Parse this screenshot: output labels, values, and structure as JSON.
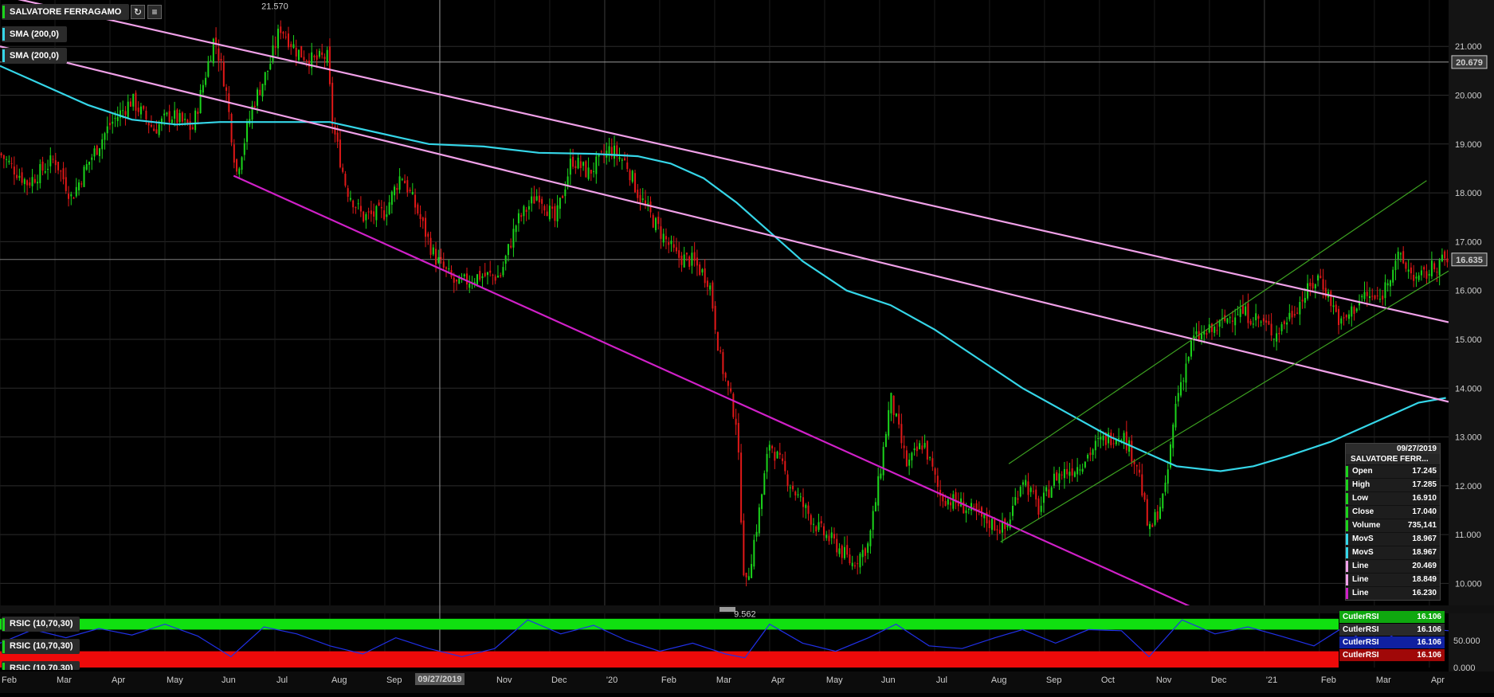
{
  "overlays": {
    "instrument": "SALVATORE FERRAGAMO",
    "sma_1": "SMA (200,0)",
    "sma_2": "SMA (200,0)",
    "rsi_1": "RSIC (10,70,30)",
    "rsi_2": "RSIC (10,70,30)",
    "rsi_3": "RSIC (10,70,30)"
  },
  "colors": {
    "up": "#1bd41b",
    "down": "#e01818",
    "sma": "#35d6e8",
    "channel_line": "#f0a0e8",
    "lower_line": "#d020c8",
    "green_channel": "#3ca020",
    "rsi_line": "#2030e8",
    "rsi_overbought": "#10e010",
    "rsi_oversold": "#ee0a0a"
  },
  "info_panel": {
    "date": "09/27/2019",
    "name": "SALVATORE FERR...",
    "rows": [
      {
        "k": "Open",
        "v": "17.245",
        "c": "#1bd41b"
      },
      {
        "k": "High",
        "v": "17.285",
        "c": "#1bd41b"
      },
      {
        "k": "Low",
        "v": "16.910",
        "c": "#1bd41b"
      },
      {
        "k": "Close",
        "v": "17.040",
        "c": "#1bd41b"
      },
      {
        "k": "Volume",
        "v": "735,141",
        "c": "#1bd41b"
      },
      {
        "k": "MovS",
        "v": "18.967",
        "c": "#35d6e8"
      },
      {
        "k": "MovS",
        "v": "18.967",
        "c": "#35d6e8"
      },
      {
        "k": "Line",
        "v": "20.469",
        "c": "#f0a0e8"
      },
      {
        "k": "Line",
        "v": "18.849",
        "c": "#f0a0e8"
      },
      {
        "k": "Line",
        "v": "16.230",
        "c": "#d020c8"
      }
    ]
  },
  "rsi_panel": {
    "rows": [
      {
        "k": "CutlerRSI",
        "v": "16.106",
        "c": "#0fa80f"
      },
      {
        "k": "CutlerRSI",
        "v": "16.106",
        "c": "#2a2a2a"
      },
      {
        "k": "CutlerRSI",
        "v": "16.106",
        "c": "#1020a0"
      },
      {
        "k": "CutlerRSI",
        "v": "16.106",
        "c": "#a00808"
      }
    ]
  },
  "chart_data": {
    "type": "candlestick",
    "instrument": "SALVATORE FERRAGAMO",
    "price_axis": {
      "ylim": [
        9.55,
        21.95
      ],
      "ticks": [
        "21.000",
        "20.000",
        "19.000",
        "18.000",
        "17.000",
        "16.000",
        "15.000",
        "14.000",
        "13.000",
        "12.000",
        "11.000",
        "10.000"
      ]
    },
    "time_axis": {
      "labels": [
        "Feb",
        "Mar",
        "Apr",
        "May",
        "Jun",
        "Jul",
        "Aug",
        "Sep",
        "09/27/2019",
        "Nov",
        "Dec",
        "'20",
        "Feb",
        "Mar",
        "Apr",
        "May",
        "Jun",
        "Jul",
        "Aug",
        "Sep",
        "Oct",
        "Nov",
        "Dec",
        "'21",
        "Feb",
        "Mar",
        "Apr"
      ],
      "label_month_index": [
        0,
        1,
        2,
        3,
        4,
        5,
        6,
        7,
        8,
        9,
        10,
        11,
        12,
        13,
        14,
        15,
        16,
        17,
        18,
        19,
        20,
        21,
        22,
        23,
        24,
        25,
        26
      ],
      "domain_months": [
        0,
        26.35
      ]
    },
    "price_labels": {
      "current": "16.635",
      "current_value": 16.635,
      "level": "20.679",
      "level_value": 20.679,
      "high": "21.570",
      "high_value": 21.57,
      "high_month": 5.0,
      "low": "9.562",
      "low_value": 9.562,
      "low_month": 13.55
    },
    "close_path": [
      [
        0.0,
        18.8
      ],
      [
        0.5,
        18.2
      ],
      [
        1.0,
        18.7
      ],
      [
        1.3,
        17.9
      ],
      [
        1.6,
        18.6
      ],
      [
        2.0,
        19.4
      ],
      [
        2.4,
        19.9
      ],
      [
        2.8,
        19.3
      ],
      [
        3.1,
        19.6
      ],
      [
        3.5,
        19.3
      ],
      [
        3.9,
        21.2
      ],
      [
        4.1,
        20.2
      ],
      [
        4.3,
        18.4
      ],
      [
        4.6,
        19.8
      ],
      [
        4.9,
        20.6
      ],
      [
        5.1,
        21.4
      ],
      [
        5.4,
        20.9
      ],
      [
        5.7,
        20.7
      ],
      [
        5.95,
        20.8
      ],
      [
        6.05,
        19.4
      ],
      [
        6.3,
        18.1
      ],
      [
        6.6,
        17.5
      ],
      [
        7.0,
        17.6
      ],
      [
        7.3,
        18.4
      ],
      [
        7.6,
        17.6
      ],
      [
        7.9,
        16.7
      ],
      [
        8.3,
        16.1
      ],
      [
        8.7,
        16.3
      ],
      [
        9.1,
        16.3
      ],
      [
        9.4,
        17.4
      ],
      [
        9.8,
        18.0
      ],
      [
        10.1,
        17.4
      ],
      [
        10.4,
        18.7
      ],
      [
        10.7,
        18.4
      ],
      [
        11.1,
        18.9
      ],
      [
        11.4,
        18.6
      ],
      [
        11.6,
        18.0
      ],
      [
        11.9,
        17.4
      ],
      [
        12.3,
        16.7
      ],
      [
        12.6,
        16.6
      ],
      [
        12.9,
        16.2
      ],
      [
        13.1,
        14.6
      ],
      [
        13.4,
        13.3
      ],
      [
        13.55,
        9.8
      ],
      [
        13.8,
        11.4
      ],
      [
        14.0,
        12.9
      ],
      [
        14.3,
        12.2
      ],
      [
        14.6,
        11.6
      ],
      [
        14.9,
        11.1
      ],
      [
        15.2,
        10.8
      ],
      [
        15.5,
        10.4
      ],
      [
        15.8,
        10.8
      ],
      [
        16.0,
        12.2
      ],
      [
        16.2,
        13.8
      ],
      [
        16.5,
        12.4
      ],
      [
        16.8,
        12.9
      ],
      [
        17.1,
        11.8
      ],
      [
        17.5,
        11.6
      ],
      [
        17.9,
        11.3
      ],
      [
        18.3,
        11.1
      ],
      [
        18.6,
        12.2
      ],
      [
        18.9,
        11.5
      ],
      [
        19.2,
        12.2
      ],
      [
        19.6,
        12.4
      ],
      [
        20.0,
        12.9
      ],
      [
        20.4,
        13.1
      ],
      [
        20.7,
        12.4
      ],
      [
        20.9,
        11.0
      ],
      [
        21.2,
        11.9
      ],
      [
        21.4,
        13.8
      ],
      [
        21.7,
        15.0
      ],
      [
        22.1,
        15.2
      ],
      [
        22.5,
        15.6
      ],
      [
        22.9,
        15.4
      ],
      [
        23.2,
        15.1
      ],
      [
        23.6,
        15.7
      ],
      [
        24.0,
        16.3
      ],
      [
        24.4,
        15.3
      ],
      [
        24.8,
        15.9
      ],
      [
        25.1,
        15.8
      ],
      [
        25.4,
        16.7
      ],
      [
        25.8,
        16.2
      ],
      [
        26.2,
        16.6
      ],
      [
        26.35,
        16.6
      ]
    ],
    "sma_path": [
      [
        0.0,
        20.6
      ],
      [
        0.8,
        20.2
      ],
      [
        1.6,
        19.8
      ],
      [
        2.4,
        19.5
      ],
      [
        3.2,
        19.4
      ],
      [
        4.0,
        19.45
      ],
      [
        5.0,
        19.45
      ],
      [
        6.0,
        19.45
      ],
      [
        6.8,
        19.25
      ],
      [
        7.8,
        19.0
      ],
      [
        8.8,
        18.95
      ],
      [
        9.8,
        18.82
      ],
      [
        10.8,
        18.8
      ],
      [
        11.6,
        18.75
      ],
      [
        12.2,
        18.6
      ],
      [
        12.8,
        18.3
      ],
      [
        13.4,
        17.8
      ],
      [
        14.0,
        17.2
      ],
      [
        14.6,
        16.6
      ],
      [
        15.4,
        16.0
      ],
      [
        16.2,
        15.7
      ],
      [
        17.0,
        15.2
      ],
      [
        17.8,
        14.6
      ],
      [
        18.6,
        14.0
      ],
      [
        19.4,
        13.5
      ],
      [
        20.2,
        13.0
      ],
      [
        20.8,
        12.7
      ],
      [
        21.4,
        12.4
      ],
      [
        22.2,
        12.3
      ],
      [
        22.8,
        12.4
      ],
      [
        23.4,
        12.6
      ],
      [
        24.2,
        12.9
      ],
      [
        25.0,
        13.3
      ],
      [
        25.8,
        13.7
      ],
      [
        26.3,
        13.8
      ]
    ],
    "trend_lines": [
      {
        "name": "Line",
        "value": 20.469,
        "style": "channel_line",
        "p1": [
          0.0,
          22.05
        ],
        "p2": [
          26.35,
          15.35
        ]
      },
      {
        "name": "Line",
        "value": 18.849,
        "style": "channel_line",
        "p1": [
          0.0,
          21.0
        ],
        "p2": [
          26.35,
          13.72
        ]
      },
      {
        "name": "Line",
        "value": 16.23,
        "style": "lower_line",
        "p1": [
          4.25,
          18.35
        ],
        "p2": [
          22.1,
          9.3
        ]
      },
      {
        "name": "channel-upper",
        "style": "green_channel",
        "p1": [
          18.35,
          12.45
        ],
        "p2": [
          25.95,
          18.25
        ]
      },
      {
        "name": "channel-lower",
        "style": "green_channel",
        "p1": [
          18.2,
          10.85
        ],
        "p2": [
          26.35,
          16.4
        ]
      }
    ],
    "rsi": {
      "labels": [
        "50.000",
        "0.000"
      ],
      "ylim": [
        0,
        100
      ],
      "overbought_band": [
        70,
        90
      ],
      "oversold_band": [
        0,
        30
      ],
      "path": [
        [
          0.0,
          45
        ],
        [
          0.6,
          70
        ],
        [
          1.2,
          55
        ],
        [
          1.8,
          72
        ],
        [
          2.4,
          60
        ],
        [
          3.0,
          80
        ],
        [
          3.6,
          58
        ],
        [
          4.2,
          20
        ],
        [
          4.8,
          75
        ],
        [
          5.4,
          62
        ],
        [
          6.0,
          40
        ],
        [
          6.6,
          25
        ],
        [
          7.2,
          55
        ],
        [
          7.8,
          35
        ],
        [
          8.4,
          20
        ],
        [
          9.0,
          35
        ],
        [
          9.6,
          88
        ],
        [
          10.2,
          62
        ],
        [
          10.8,
          78
        ],
        [
          11.4,
          50
        ],
        [
          12.0,
          30
        ],
        [
          12.6,
          45
        ],
        [
          13.2,
          25
        ],
        [
          13.55,
          18
        ],
        [
          14.0,
          80
        ],
        [
          14.6,
          45
        ],
        [
          15.2,
          30
        ],
        [
          15.8,
          55
        ],
        [
          16.3,
          80
        ],
        [
          16.9,
          40
        ],
        [
          17.5,
          35
        ],
        [
          18.1,
          55
        ],
        [
          18.6,
          70
        ],
        [
          19.2,
          45
        ],
        [
          19.8,
          70
        ],
        [
          20.4,
          68
        ],
        [
          20.9,
          20
        ],
        [
          21.5,
          88
        ],
        [
          22.1,
          62
        ],
        [
          22.7,
          75
        ],
        [
          23.3,
          58
        ],
        [
          23.9,
          40
        ],
        [
          24.4,
          72
        ],
        [
          25.0,
          40
        ],
        [
          25.6,
          75
        ],
        [
          26.35,
          68
        ]
      ]
    }
  }
}
